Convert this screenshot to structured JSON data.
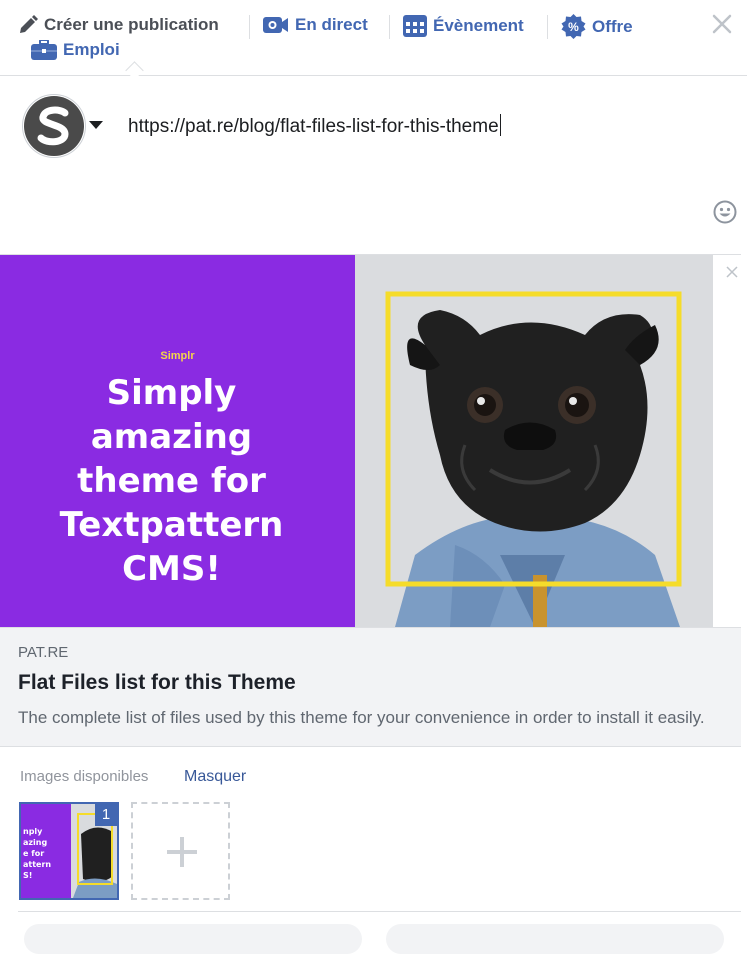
{
  "tabs": [
    {
      "label": "Créer une publication",
      "icon": "pencil-icon",
      "active": true
    },
    {
      "label": "En direct",
      "icon": "live-video-icon"
    },
    {
      "label": "Évènement",
      "icon": "calendar-icon"
    },
    {
      "label": "Offre",
      "icon": "offer-badge-icon"
    },
    {
      "label": "Emploi",
      "icon": "briefcase-icon"
    }
  ],
  "composer": {
    "input_value": "https://pat.re/blog/flat-files-list-for-this-theme"
  },
  "preview": {
    "brand": "Simplr",
    "headline_lines": [
      "Simply",
      "amazing",
      "theme for",
      "Textpattern",
      "CMS!"
    ],
    "domain": "PAT.RE",
    "title": "Flat Files list for this Theme",
    "description": "The complete list of files used by this theme for your convenience in order to install it easily."
  },
  "images": {
    "label": "Images disponibles",
    "hide_label": "Masquer",
    "thumb_number": "1"
  },
  "colors": {
    "brand_blue": "#4267b2",
    "promo_purple": "#8a2be2",
    "promo_yellow": "#f5d54a"
  }
}
